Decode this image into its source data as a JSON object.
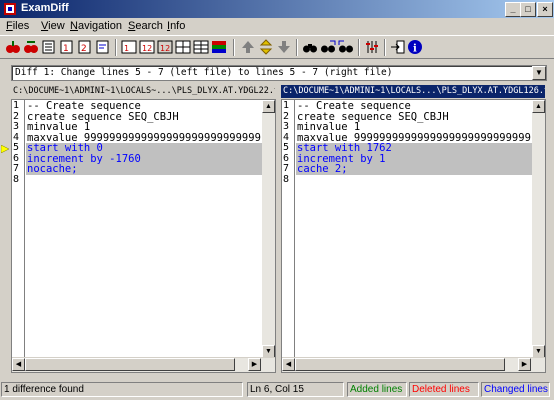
{
  "window": {
    "title": "ExamDiff"
  },
  "menu": [
    "Files",
    "View",
    "Navigation",
    "Search",
    "Info"
  ],
  "toolbar": {
    "icons": [
      "open-files-icon",
      "compare-icon",
      "recompare-icon",
      "save-icon",
      "edit-icon",
      "print-icon",
      "view-left-icon",
      "view-right-icon",
      "view-both-icon",
      "split-vertical-icon",
      "split-horizontal-icon",
      "color-icon",
      "first-diff-icon",
      "current-diff-icon",
      "next-diff-icon",
      "find-icon",
      "find-next-icon",
      "find-prev-icon",
      "options-icon",
      "exit-icon",
      "about-icon"
    ]
  },
  "diff_selector": {
    "value": "Diff 1: Change lines 5 - 7 (left file) to lines 5 - 7 (right file)"
  },
  "left": {
    "path": "C:\\DOCUME~1\\ADMINI~1\\LOCALS~...\\PLS_DLYX.AT.YDGL22.txt",
    "lines": [
      {
        "num": "1",
        "text": "-- Create sequence",
        "changed": false
      },
      {
        "num": "2",
        "text": "create sequence SEQ_CBJH",
        "changed": false
      },
      {
        "num": "3",
        "text": "minvalue 1",
        "changed": false
      },
      {
        "num": "4",
        "text": "maxvalue 9999999999999999999999999999",
        "changed": false
      },
      {
        "num": "5",
        "text": "start with 0",
        "changed": true
      },
      {
        "num": "6",
        "text": "increment by -1760",
        "changed": true
      },
      {
        "num": "7",
        "text": "nocache;",
        "changed": true
      },
      {
        "num": "8",
        "text": "",
        "changed": false
      }
    ]
  },
  "right": {
    "path": "C:\\DOCUME~1\\ADMINI~1\\LOCALS...\\PLS_DLYX.AT.YDGL126.txt",
    "lines": [
      {
        "num": "1",
        "text": "-- Create sequence",
        "changed": false
      },
      {
        "num": "2",
        "text": "create sequence SEQ_CBJH",
        "changed": false
      },
      {
        "num": "3",
        "text": "minvalue 1",
        "changed": false
      },
      {
        "num": "4",
        "text": "maxvalue 9999999999999999999999999999",
        "changed": false
      },
      {
        "num": "5",
        "text": "start with 1762",
        "changed": true
      },
      {
        "num": "6",
        "text": "increment by 1",
        "changed": true
      },
      {
        "num": "7",
        "text": "cache 2;",
        "changed": true
      },
      {
        "num": "8",
        "text": "",
        "changed": false
      }
    ]
  },
  "status": {
    "message": "1 difference found",
    "position": "Ln 6, Col 15",
    "added": "Added lines",
    "deleted": "Deleted lines",
    "changed": "Changed lines"
  },
  "colors": {
    "added": "#008000",
    "deleted": "#ff0000",
    "changed": "#0000ff",
    "active_header": "#0a246a",
    "changed_bg": "#c0c0c0"
  }
}
